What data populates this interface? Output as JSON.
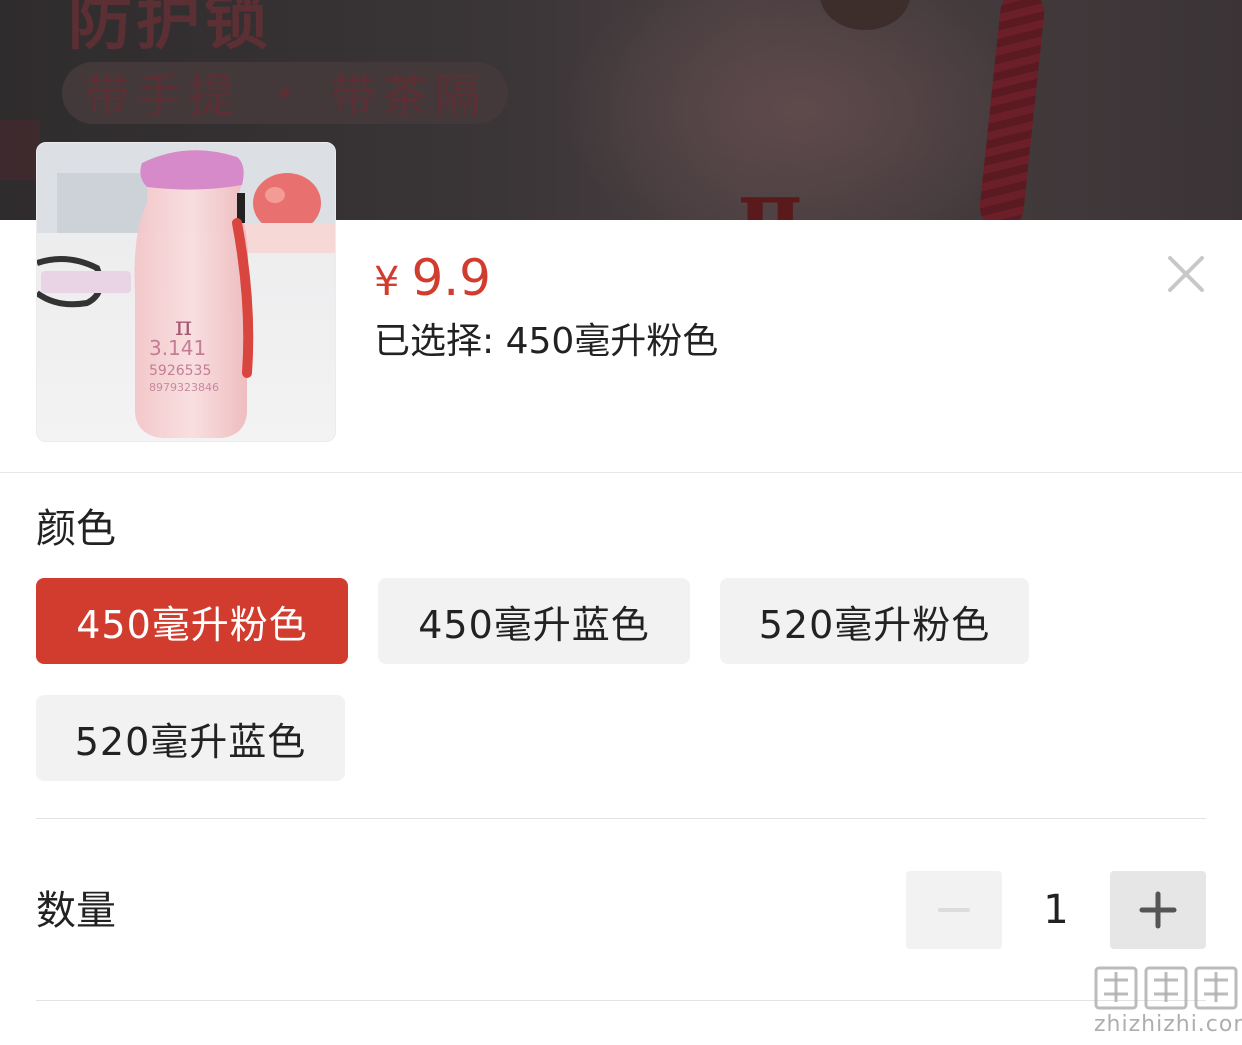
{
  "banner": {
    "title": "防护锁",
    "tag_1": "带手提",
    "tag_2": "带茶隔"
  },
  "product": {
    "thumb_icon": "pink-water-bottle-image",
    "price_currency": "¥",
    "price_value": "9.9",
    "selected_label": "已选择: 450毫升粉色",
    "close_icon": "close-icon"
  },
  "color_section": {
    "label": "颜色",
    "options": [
      {
        "label": "450毫升粉色",
        "selected": true
      },
      {
        "label": "450毫升蓝色",
        "selected": false
      },
      {
        "label": "520毫升粉色",
        "selected": false
      },
      {
        "label": "520毫升蓝色",
        "selected": false
      }
    ]
  },
  "quantity_section": {
    "label": "数量",
    "value": "1",
    "minus_icon": "minus-icon",
    "plus_icon": "plus-icon",
    "minus_enabled": false,
    "plus_enabled": true
  },
  "watermark": {
    "logo_text": "值值值",
    "site": "zhizhizhi.com"
  },
  "colors": {
    "accent": "#d23c2f",
    "option_bg": "#f2f2f2",
    "divider": "#e6e6e6"
  }
}
